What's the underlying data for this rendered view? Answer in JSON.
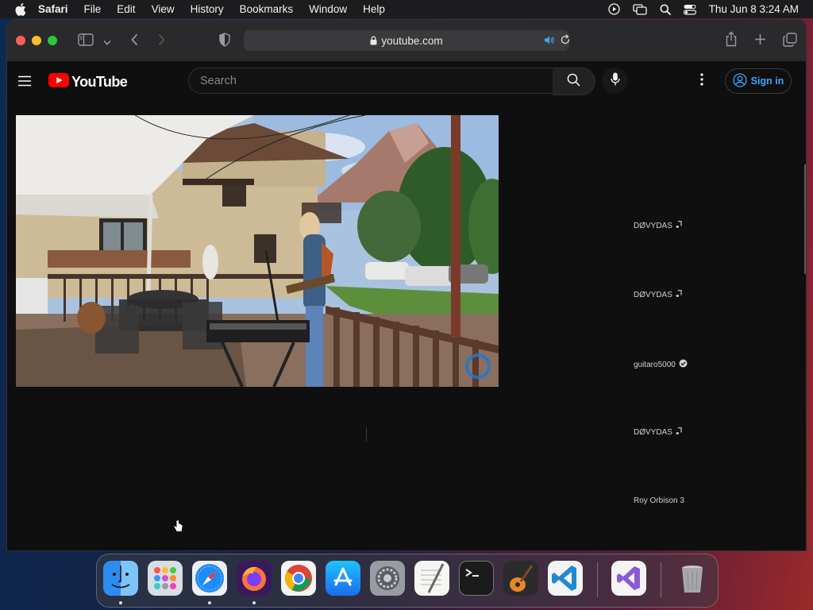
{
  "menubar": {
    "app_name": "Safari",
    "items": [
      "File",
      "Edit",
      "View",
      "History",
      "Bookmarks",
      "Window",
      "Help"
    ],
    "clock": "Thu Jun 8  3:24 AM"
  },
  "browser": {
    "url": "youtube.com"
  },
  "youtube": {
    "logo_text": "YouTube",
    "search_placeholder": "Search",
    "signin_label": "Sign in",
    "recommendations": [
      {
        "channel": "DØVYDAS",
        "badge": "music-note-icon"
      },
      {
        "channel": "DØVYDAS",
        "badge": "music-note-icon"
      },
      {
        "channel": "guitaro5000",
        "badge": "verified-check-icon"
      },
      {
        "channel": "DØVYDAS",
        "badge": "music-note-icon"
      },
      {
        "channel": "Roy Orbison 3",
        "badge": ""
      }
    ]
  },
  "dock": {
    "apps": [
      "Finder",
      "Launchpad",
      "Safari",
      "Firefox",
      "Chrome",
      "App Store",
      "System Settings",
      "TextEdit",
      "Terminal",
      "GarageBand",
      "VS Code",
      "Visual Studio",
      "Trash"
    ]
  },
  "colors": {
    "accent_link": "#3ea6ff",
    "youtube_red": "#ff0000",
    "page_bg": "#0f0f0f"
  }
}
